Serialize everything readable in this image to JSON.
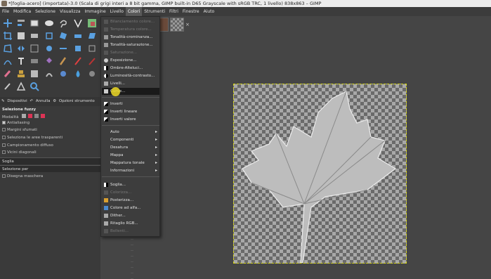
{
  "window": {
    "title": "*[foglia-acero] (importata)-3.0 (Scala di grigi interi a 8 bit gamma, GIMP built-in D65 Grayscale with sRGB TRC, 1 livello) 838x863 – GIMP"
  },
  "menubar": {
    "items": [
      "File",
      "Modifica",
      "Selezione",
      "Visualizza",
      "Immagine",
      "Livello",
      "Colori",
      "Strumenti",
      "Filtri",
      "Finestre",
      "Aiuto"
    ],
    "active": "Colori"
  },
  "colors": {
    "foreground": "#e00010",
    "background": "#ffffff",
    "selection_marquee": "#d9d91a",
    "menu_highlight": "#1a1a1a"
  },
  "tabs": {
    "devices": "Dispositivi",
    "undo": "Annulla",
    "tool_options": "Opzioni strumento"
  },
  "tool_options": {
    "title": "Selezione fuzzy",
    "mode_label": "Modalità",
    "antialiasing": "Antialiasing",
    "feather": "Margini sfumati",
    "select_transparent": "Seleziona le aree trasparenti",
    "sample_merged": "Campionamento diffuso",
    "diagonal": "Vicini diagonali",
    "threshold_label": "Soglia",
    "select_by_label": "Selezione per",
    "draw_mask": "Disegna maschera"
  },
  "colori_menu": {
    "group1": [
      {
        "label": "Bilanciamento colore...",
        "disabled": true,
        "icon": "balance-icon"
      },
      {
        "label": "Temperatura colore...",
        "disabled": true,
        "icon": "temperature-icon"
      },
      {
        "label": "Tonalità-crominanza...",
        "disabled": false,
        "icon": "hue-chroma-icon"
      },
      {
        "label": "Tonalità-saturazione...",
        "disabled": false,
        "icon": "hue-sat-icon"
      },
      {
        "label": "Saturazione...",
        "disabled": true,
        "icon": "saturation-icon"
      },
      {
        "label": "Esposizione...",
        "disabled": false,
        "icon": "exposure-icon"
      },
      {
        "label": "Ombre-Alteluci...",
        "disabled": false,
        "icon": "shadows-icon"
      },
      {
        "label": "Luminosità-contrasto...",
        "disabled": false,
        "icon": "brightness-icon"
      },
      {
        "label": "Livelli...",
        "disabled": false,
        "icon": "levels-icon"
      },
      {
        "label": "Curve...",
        "disabled": false,
        "icon": "curves-icon",
        "highlighted": true
      }
    ],
    "group2": [
      {
        "label": "Inverti",
        "icon": "invert-icon"
      },
      {
        "label": "Inverti lineare",
        "icon": "invert-linear-icon"
      },
      {
        "label": "Inverti valore",
        "icon": "invert-value-icon"
      }
    ],
    "submenus": [
      "Auto",
      "Componenti",
      "Desatura",
      "Mappa",
      "Mappatura tonale",
      "Informazioni"
    ],
    "group3": [
      {
        "label": "Soglia...",
        "disabled": false,
        "icon": "threshold-icon"
      },
      {
        "label": "Colorizza...",
        "disabled": true,
        "icon": "colorize-icon"
      },
      {
        "label": "Posterizza...",
        "disabled": false,
        "icon": "posterize-icon"
      },
      {
        "label": "Colore ad alfa...",
        "disabled": false,
        "icon": "color-to-alpha-icon"
      },
      {
        "label": "Dither...",
        "disabled": false,
        "icon": "dither-icon"
      },
      {
        "label": "Ritaglio RGB...",
        "disabled": false,
        "icon": "rgb-clip-icon"
      },
      {
        "label": "Bollenti...",
        "disabled": true,
        "icon": "hot-icon"
      }
    ]
  }
}
